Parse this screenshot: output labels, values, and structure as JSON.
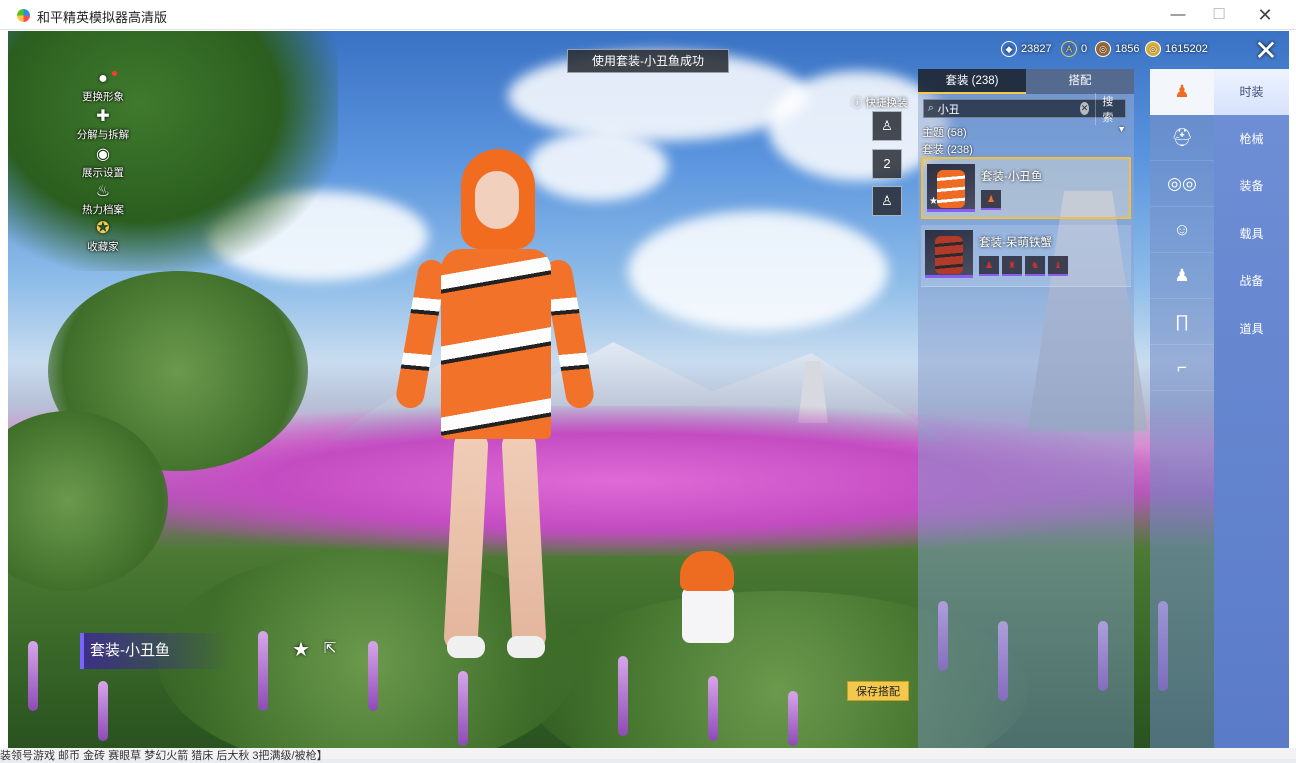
{
  "window": {
    "title": "和平精英模拟器高清版",
    "min_icon": "minimize-icon",
    "max_icon": "maximize-icon",
    "close_icon": "close-icon"
  },
  "left_menu": [
    {
      "label": "更换形象",
      "icon": "person-icon"
    },
    {
      "label": "分解与拆解",
      "icon": "puzzle-icon"
    },
    {
      "label": "展示设置",
      "icon": "eye-icon"
    },
    {
      "label": "热力档案",
      "icon": "flame-icon"
    },
    {
      "label": "收藏家",
      "icon": "medal-icon"
    }
  ],
  "toast": "使用套装-小丑鱼成功",
  "currencies": [
    {
      "icon": "gem-icon",
      "value": "23827"
    },
    {
      "icon": "token-icon",
      "value": "0"
    },
    {
      "icon": "bronze-coin-icon",
      "value": "1856"
    },
    {
      "icon": "gold-coin-icon",
      "value": "1615202"
    }
  ],
  "quick_change": {
    "label": "快捷换装",
    "slot_2_label": "2"
  },
  "panel": {
    "tabs": [
      "套装 (238)",
      "搭配"
    ],
    "search_value": "小丑",
    "search_button": "搜索",
    "filter_label": "主题 (58)",
    "subtitle": "套装 (238)",
    "items": [
      {
        "name": "套装-小丑鱼",
        "selected": true
      },
      {
        "name": "套装-呆萌铁蟹",
        "selected": false
      }
    ]
  },
  "icon_column": [
    "outfit-icon",
    "hat-icon",
    "glasses-icon",
    "face-icon",
    "top-icon",
    "pants-icon",
    "shoes-icon"
  ],
  "categories": [
    "时装",
    "枪械",
    "装备",
    "载具",
    "战备",
    "道具"
  ],
  "bottom": {
    "outfit_name": "套装-小丑鱼",
    "save_button": "保存搭配"
  },
  "background_text": "装领号游戏 邮币 金砖 赛眼草 梦幻火箭 猎床 后大秋 3把满级/被枪】"
}
